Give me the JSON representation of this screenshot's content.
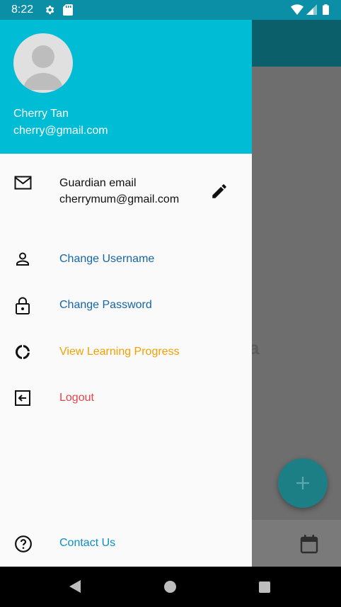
{
  "status_bar": {
    "time": "8:22",
    "icons": [
      "gear-icon",
      "sd-card-icon",
      "wifi-icon",
      "signal-icon",
      "battery-icon"
    ]
  },
  "background": {
    "partial_text": "a",
    "fab_icon": "plus-icon",
    "bottom_icon": "calendar-icon"
  },
  "drawer": {
    "user": {
      "name": "Cherry Tan",
      "email": "cherry@gmail.com"
    },
    "guardian": {
      "label": "Guardian email",
      "value": "cherrymum@gmail.com",
      "icon": "mail-icon",
      "edit_icon": "pencil-icon"
    },
    "menu": {
      "change_username": {
        "label": "Change Username",
        "icon": "person-icon",
        "color": "#1565a8"
      },
      "change_password": {
        "label": "Change Password",
        "icon": "lock-icon",
        "color": "#1565a8"
      },
      "view_progress": {
        "label": "View Learning Progress",
        "icon": "progress-ring-icon",
        "color": "#f5a000"
      },
      "logout": {
        "label": "Logout",
        "icon": "logout-icon",
        "color": "#e8424b"
      },
      "contact": {
        "label": "Contact Us",
        "icon": "help-icon",
        "color": "#0a8fc9"
      }
    },
    "header_color": "#00bcd4"
  }
}
